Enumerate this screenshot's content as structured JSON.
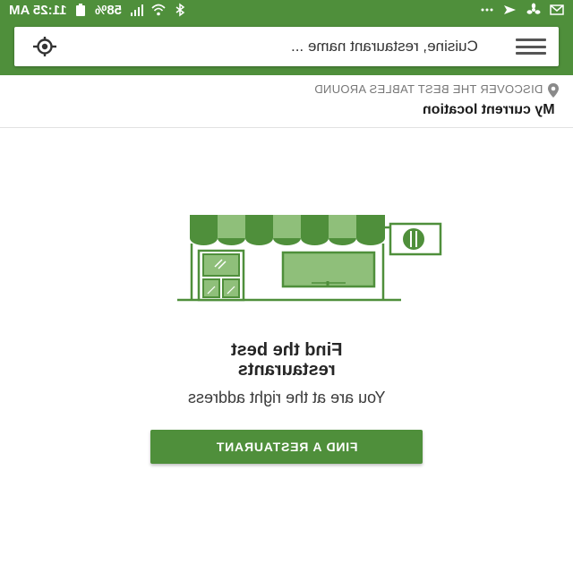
{
  "status_bar": {
    "time": "11:25 AM",
    "battery": "58%",
    "icons": [
      "battery-icon",
      "signal-icon",
      "wifi-icon",
      "bluetooth-icon",
      "more-icon",
      "cast-icon",
      "fan-icon",
      "mail-icon"
    ]
  },
  "search": {
    "placeholder": "Cuisine, restaurant name ..."
  },
  "location": {
    "caption": "DISCOVER THE BEST TABLES AROUND",
    "value": "My current location"
  },
  "main": {
    "headline": "Find the best\nrestaurants",
    "subheadline": "You are at the right address",
    "button_label": "FIND A RESTAURANT"
  },
  "colors": {
    "brand": "#4f8f3b",
    "brand_light": "#8fbf7a"
  }
}
